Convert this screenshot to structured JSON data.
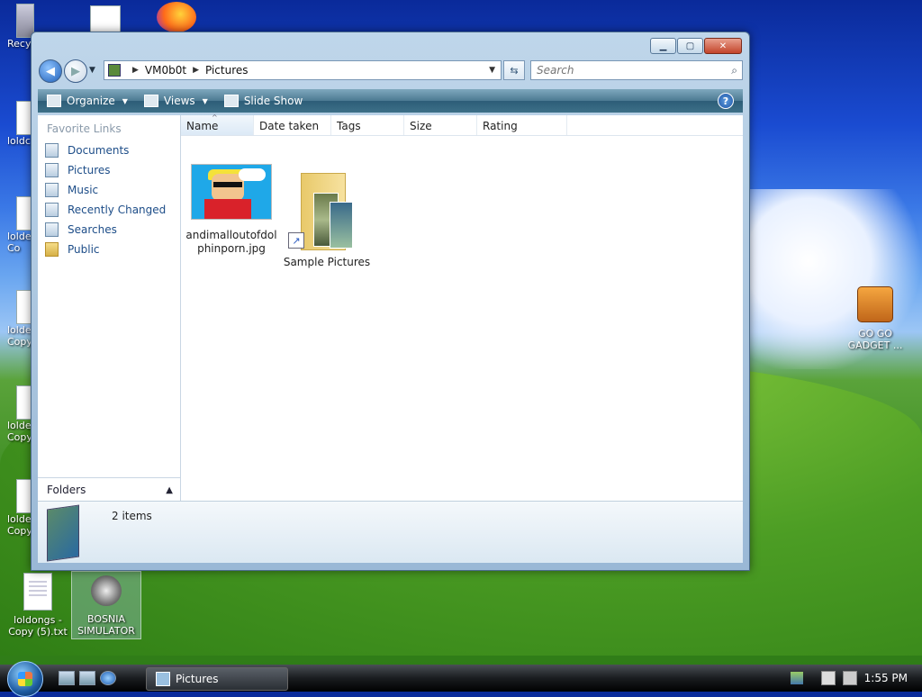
{
  "desktop": {
    "icons": [
      {
        "label": "Recy"
      },
      {
        "label": "loldc"
      },
      {
        "label": "lolde Co"
      },
      {
        "label": "lolde Copy"
      },
      {
        "label": "lolde Copy"
      },
      {
        "label": "lolde Copy"
      },
      {
        "label": "loldongs - Copy (5).txt"
      },
      {
        "label": "BOSNIA SIMULATOR"
      },
      {
        "label": "GO GO GADGET ..."
      }
    ]
  },
  "window": {
    "address": {
      "segments": [
        "VM0b0t",
        "Pictures"
      ]
    },
    "search": {
      "placeholder": "Search"
    },
    "toolbar": {
      "organize": "Organize",
      "views": "Views",
      "slideshow": "Slide Show"
    },
    "favorites": {
      "header": "Favorite Links",
      "links": [
        "Documents",
        "Pictures",
        "Music",
        "Recently Changed",
        "Searches",
        "Public"
      ]
    },
    "folders_label": "Folders",
    "columns": [
      "Name",
      "Date taken",
      "Tags",
      "Size",
      "Rating"
    ],
    "items": [
      {
        "name": "andimalloutofdolphinporn.jpg"
      },
      {
        "name": "Sample Pictures"
      }
    ],
    "status": {
      "count": "2 items"
    }
  },
  "taskbar": {
    "task_label": "Pictures",
    "clock": "1:55 PM"
  }
}
